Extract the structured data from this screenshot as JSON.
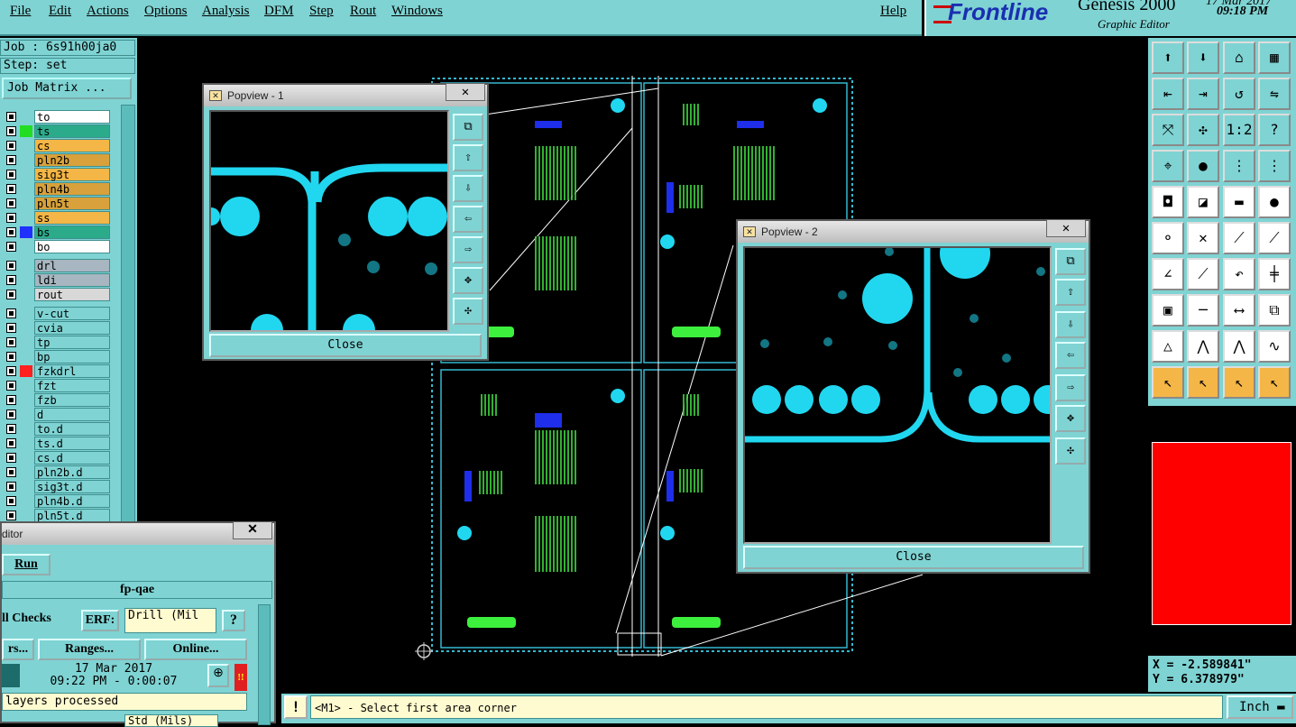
{
  "menu": {
    "file": "File",
    "edit": "Edit",
    "actions": "Actions",
    "options": "Options",
    "analysis": "Analysis",
    "dfm": "DFM",
    "step": "Step",
    "rout": "Rout",
    "windows": "Windows",
    "help": "Help"
  },
  "logo": {
    "brand": "Frontline",
    "product": "Genesis 2000",
    "subtitle": "Graphic Editor",
    "date": "17 Mar 2017",
    "time": "09:18 PM"
  },
  "job": {
    "job": "Job : 6s91h00ja0",
    "step": "Step: set",
    "matrix_button": "Job Matrix ..."
  },
  "layers": [
    {
      "name": "to",
      "color": "#ffffff",
      "swatch": ""
    },
    {
      "name": "ts",
      "color": "#2bab8a",
      "swatch": "#22dd22"
    },
    {
      "name": "cs",
      "color": "#f4b646",
      "swatch": ""
    },
    {
      "name": "pln2b",
      "color": "#d8a13b",
      "swatch": ""
    },
    {
      "name": "sig3t",
      "color": "#f4b646",
      "swatch": ""
    },
    {
      "name": "pln4b",
      "color": "#d8a13b",
      "swatch": ""
    },
    {
      "name": "pln5t",
      "color": "#d8a13b",
      "swatch": ""
    },
    {
      "name": "ss",
      "color": "#f4b646",
      "swatch": ""
    },
    {
      "name": "bs",
      "color": "#2bab8a",
      "swatch": "#2030ff"
    },
    {
      "name": "bo",
      "color": "#ffffff",
      "swatch": ""
    },
    {
      "name": "drl",
      "color": "#a7b6c0",
      "swatch": ""
    },
    {
      "name": "ldi",
      "color": "#a7b6c0",
      "swatch": ""
    },
    {
      "name": "rout",
      "color": "#d8d8d8",
      "swatch": ""
    },
    {
      "name": "v-cut",
      "color": "#7fd3d3",
      "swatch": ""
    },
    {
      "name": "cvia",
      "color": "#7fd3d3",
      "swatch": ""
    },
    {
      "name": "tp",
      "color": "#7fd3d3",
      "swatch": ""
    },
    {
      "name": "bp",
      "color": "#7fd3d3",
      "swatch": ""
    },
    {
      "name": "fzkdrl",
      "color": "#7fd3d3",
      "swatch": "#ff2020"
    },
    {
      "name": "fzt",
      "color": "#7fd3d3",
      "swatch": ""
    },
    {
      "name": "fzb",
      "color": "#7fd3d3",
      "swatch": ""
    },
    {
      "name": "d",
      "color": "#7fd3d3",
      "swatch": ""
    },
    {
      "name": "to.d",
      "color": "#7fd3d3",
      "swatch": ""
    },
    {
      "name": "ts.d",
      "color": "#7fd3d3",
      "swatch": ""
    },
    {
      "name": "cs.d",
      "color": "#7fd3d3",
      "swatch": ""
    },
    {
      "name": "pln2b.d",
      "color": "#7fd3d3",
      "swatch": ""
    },
    {
      "name": "sig3t.d",
      "color": "#7fd3d3",
      "swatch": ""
    },
    {
      "name": "pln4b.d",
      "color": "#7fd3d3",
      "swatch": ""
    },
    {
      "name": "pln5t.d",
      "color": "#7fd3d3",
      "swatch": ""
    }
  ],
  "popview1": {
    "title": "Popview - 1",
    "close": "Close"
  },
  "popview2": {
    "title": "Popview - 2",
    "close": "Close"
  },
  "editor": {
    "title": "ditor",
    "run": "Run",
    "program": "fp-qae",
    "checks": "ll Checks",
    "erf_label": "ERF:",
    "erf_value": "Drill (Mil",
    "help": "?",
    "rs": "rs...",
    "ranges": "Ranges...",
    "online": "Online...",
    "date": "17 Mar 2017",
    "time": "09:22 PM - 0:00:07",
    "alert": "!!",
    "processed": "layers processed",
    "std_value": "Std (Mils)"
  },
  "coords": {
    "x": "X = -2.589841\"",
    "y": "Y = 6.378979\""
  },
  "status": {
    "warn": "!",
    "message": "<M1> - Select first area corner",
    "unit": "Inch"
  }
}
